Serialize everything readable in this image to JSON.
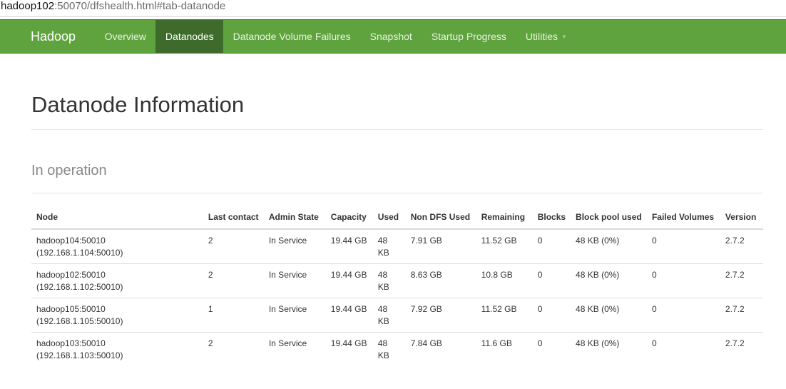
{
  "address_bar": {
    "host": "hadoop102",
    "rest": ":50070/dfshealth.html#tab-datanode"
  },
  "navbar": {
    "brand": "Hadoop",
    "items": [
      {
        "label": "Overview"
      },
      {
        "label": "Datanodes",
        "active": true
      },
      {
        "label": "Datanode Volume Failures"
      },
      {
        "label": "Snapshot"
      },
      {
        "label": "Startup Progress"
      },
      {
        "label": "Utilities",
        "dropdown": true
      }
    ]
  },
  "page": {
    "title": "Datanode Information",
    "section_title": "In operation"
  },
  "table": {
    "headers": {
      "node": "Node",
      "last_contact": "Last contact",
      "admin_state": "Admin State",
      "capacity": "Capacity",
      "used": "Used",
      "non_dfs_used": "Non DFS Used",
      "remaining": "Remaining",
      "blocks": "Blocks",
      "block_pool_used": "Block pool used",
      "failed_volumes": "Failed Volumes",
      "version": "Version"
    },
    "rows": [
      {
        "node": "hadoop104:50010",
        "node_ip": "(192.168.1.104:50010)",
        "last_contact": "2",
        "admin_state": "In Service",
        "capacity": "19.44 GB",
        "used": "48 KB",
        "non_dfs_used": "7.91 GB",
        "remaining": "11.52 GB",
        "blocks": "0",
        "block_pool_used": "48 KB (0%)",
        "failed_volumes": "0",
        "version": "2.7.2"
      },
      {
        "node": "hadoop102:50010",
        "node_ip": "(192.168.1.102:50010)",
        "last_contact": "2",
        "admin_state": "In Service",
        "capacity": "19.44 GB",
        "used": "48 KB",
        "non_dfs_used": "8.63 GB",
        "remaining": "10.8 GB",
        "blocks": "0",
        "block_pool_used": "48 KB (0%)",
        "failed_volumes": "0",
        "version": "2.7.2"
      },
      {
        "node": "hadoop105:50010",
        "node_ip": "(192.168.1.105:50010)",
        "last_contact": "1",
        "admin_state": "In Service",
        "capacity": "19.44 GB",
        "used": "48 KB",
        "non_dfs_used": "7.92 GB",
        "remaining": "11.52 GB",
        "blocks": "0",
        "block_pool_used": "48 KB (0%)",
        "failed_volumes": "0",
        "version": "2.7.2"
      },
      {
        "node": "hadoop103:50010",
        "node_ip": "(192.168.1.103:50010)",
        "last_contact": "2",
        "admin_state": "In Service",
        "capacity": "19.44 GB",
        "used": "48 KB",
        "non_dfs_used": "7.84 GB",
        "remaining": "11.6 GB",
        "blocks": "0",
        "block_pool_used": "48 KB (0%)",
        "failed_volumes": "0",
        "version": "2.7.2"
      }
    ]
  }
}
